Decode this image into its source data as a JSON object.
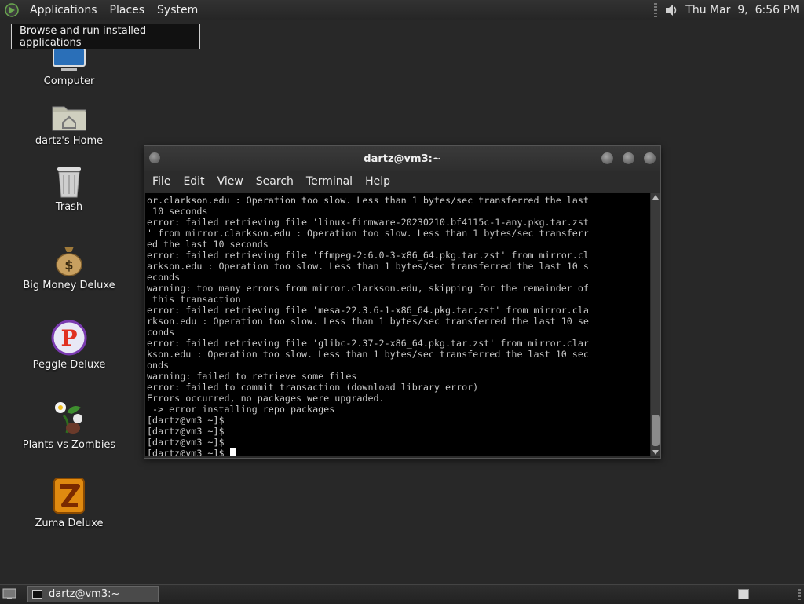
{
  "top_panel": {
    "menu": [
      "Applications",
      "Places",
      "System"
    ],
    "clock": "Thu Mar  9,  6:56 PM"
  },
  "tooltip": "Browse and run installed applications",
  "desktop_icons": [
    {
      "label": "Computer",
      "icon": "computer-icon"
    },
    {
      "label": "dartz's Home",
      "icon": "home-folder-icon"
    },
    {
      "label": "Trash",
      "icon": "trash-icon"
    },
    {
      "label": "Big Money Deluxe",
      "icon": "money-bag-icon"
    },
    {
      "label": "Peggle Deluxe",
      "icon": "peggle-icon"
    },
    {
      "label": "Plants vs Zombies",
      "icon": "plants-icon"
    },
    {
      "label": "Zuma Deluxe",
      "icon": "zuma-icon"
    }
  ],
  "terminal": {
    "title": "dartz@vm3:~",
    "menu": [
      "File",
      "Edit",
      "View",
      "Search",
      "Terminal",
      "Help"
    ],
    "lines": [
      "or.clarkson.edu : Operation too slow. Less than 1 bytes/sec transferred the last",
      " 10 seconds",
      "error: failed retrieving file 'linux-firmware-20230210.bf4115c-1-any.pkg.tar.zst",
      "' from mirror.clarkson.edu : Operation too slow. Less than 1 bytes/sec transferr",
      "ed the last 10 seconds",
      "error: failed retrieving file 'ffmpeg-2:6.0-3-x86_64.pkg.tar.zst' from mirror.cl",
      "arkson.edu : Operation too slow. Less than 1 bytes/sec transferred the last 10 s",
      "econds",
      "warning: too many errors from mirror.clarkson.edu, skipping for the remainder of",
      " this transaction",
      "error: failed retrieving file 'mesa-22.3.6-1-x86_64.pkg.tar.zst' from mirror.cla",
      "rkson.edu : Operation too slow. Less than 1 bytes/sec transferred the last 10 se",
      "conds",
      "error: failed retrieving file 'glibc-2.37-2-x86_64.pkg.tar.zst' from mirror.clar",
      "kson.edu : Operation too slow. Less than 1 bytes/sec transferred the last 10 sec",
      "onds",
      "warning: failed to retrieve some files",
      "error: failed to commit transaction (download library error)",
      "Errors occurred, no packages were upgraded.",
      " -> error installing repo packages",
      "[dartz@vm3 ~]$",
      "[dartz@vm3 ~]$",
      "[dartz@vm3 ~]$",
      "[dartz@vm3 ~]$ "
    ]
  },
  "taskbar": {
    "task_label": "dartz@vm3:~"
  }
}
